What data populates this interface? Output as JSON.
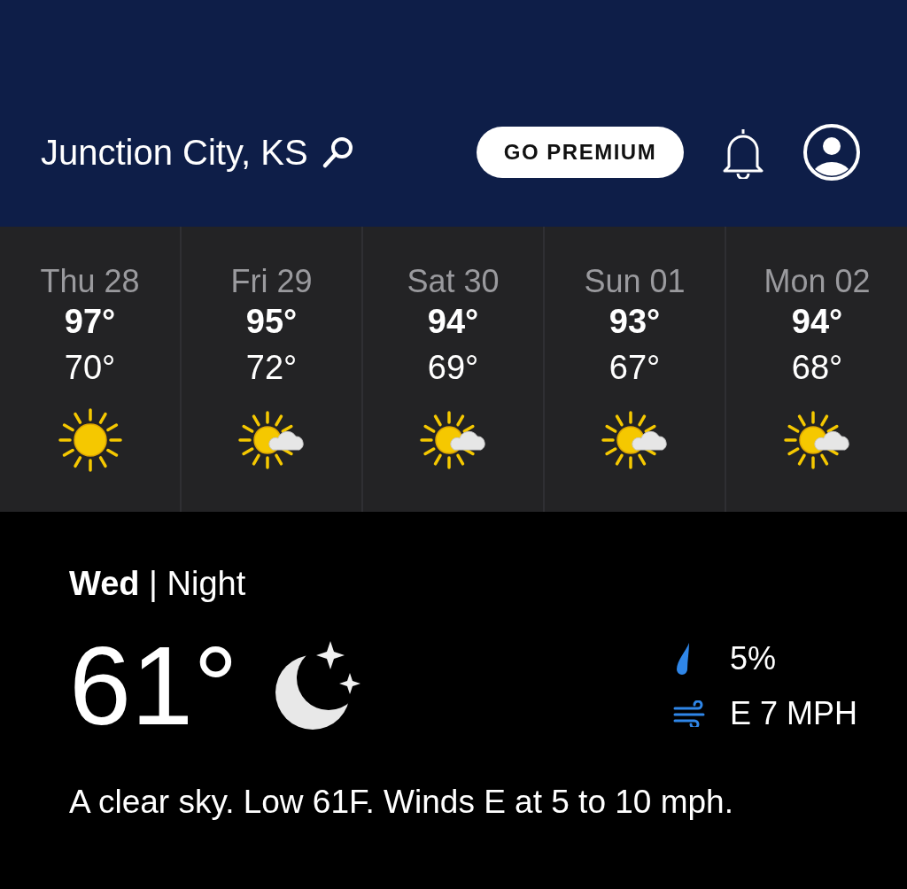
{
  "header": {
    "location": "Junction City, KS",
    "premium_button": "GO PREMIUM"
  },
  "forecast": [
    {
      "day": "Thu 28",
      "high": "97°",
      "low": "70°",
      "kind": "sunny"
    },
    {
      "day": "Fri 29",
      "high": "95°",
      "low": "72°",
      "kind": "partly-sunny"
    },
    {
      "day": "Sat 30",
      "high": "94°",
      "low": "69°",
      "kind": "partly-sunny"
    },
    {
      "day": "Sun 01",
      "high": "93°",
      "low": "67°",
      "kind": "partly-sunny"
    },
    {
      "day": "Mon 02",
      "high": "94°",
      "low": "68°",
      "kind": "partly-sunny"
    }
  ],
  "current": {
    "period": "**Wed** | Night",
    "temperature": "61°",
    "kind": "clear-night",
    "precipitation": "5%",
    "wind": "E 7 MPH",
    "description": "A clear sky. Low 61F. Winds E at 5 to 10 mph."
  }
}
